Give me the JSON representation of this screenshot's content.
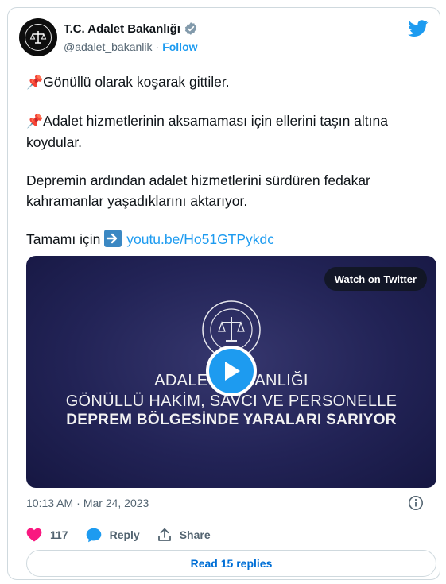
{
  "account": {
    "display_name": "T.C. Adalet Bakanlığı",
    "handle": "@adalet_bakanlik",
    "separator": "·",
    "follow_label": "Follow",
    "verified": true
  },
  "tweet": {
    "pin_emoji": "📌",
    "line1": "Gönüllü olarak koşarak gittiler.",
    "line2": "Adalet hizmetlerinin aksamaması için ellerini taşın altına koydular.",
    "line3": "Depremin ardından adalet hizmetlerini sürdüren fedakar kahramanlar yaşadıklarını aktarıyor.",
    "line4_prefix": "Tamamı için",
    "link": "youtu.be/Ho51GTPykdc"
  },
  "video": {
    "watch_label": "Watch on Twitter",
    "caption_line1": "ADALET BAKANLIĞI",
    "caption_line2": "GÖNÜLLÜ HAKİM, SAVCI VE PERSONELLE",
    "caption_line3": "DEPREM BÖLGESİNDE YARALARI SARIYOR"
  },
  "meta": {
    "time": "10:13 AM",
    "separator": "·",
    "date": "Mar 24, 2023"
  },
  "actions": {
    "like_count": "117",
    "reply_label": "Reply",
    "share_label": "Share",
    "read_replies_label": "Read 15 replies"
  },
  "colors": {
    "accent": "#1d9bf0",
    "like": "#f91880",
    "text": "#0f1419",
    "muted": "#536471",
    "border": "#cfd9de",
    "video_bg": "#222356"
  }
}
